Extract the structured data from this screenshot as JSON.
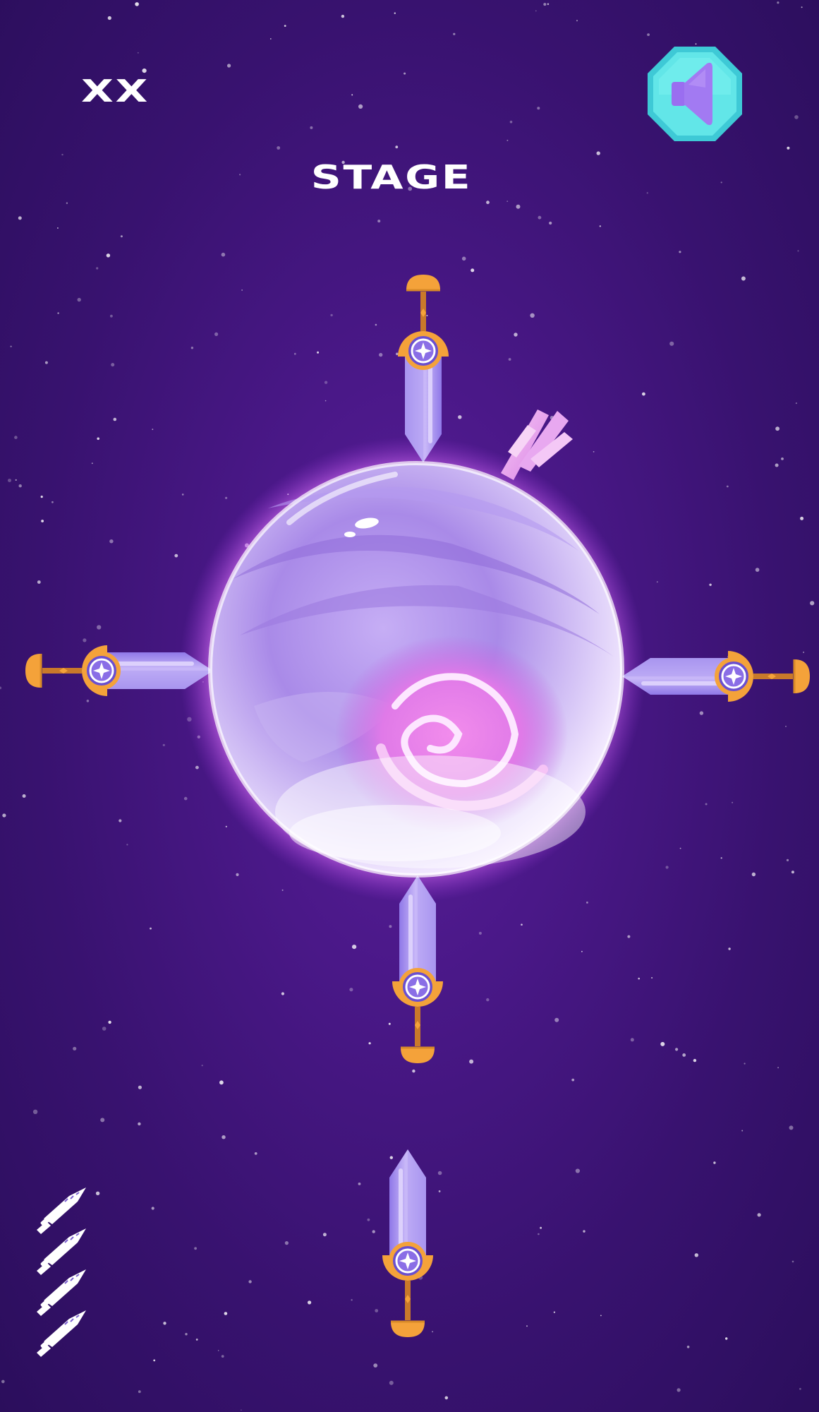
{
  "hud": {
    "score": "XX",
    "stage_label": "STAGE"
  },
  "sound_button": {
    "icon": "speaker-icon"
  },
  "colors": {
    "background": "#4a1888",
    "planet_glow": "#e47bff",
    "button_face": "#5fe3e6",
    "speaker": "#a074f0",
    "blade": "#b9a6f5",
    "guard": "#f4a23a",
    "gem": "#6a4fd0"
  },
  "game": {
    "stuck_knives": 4,
    "remaining_knives": 4
  }
}
